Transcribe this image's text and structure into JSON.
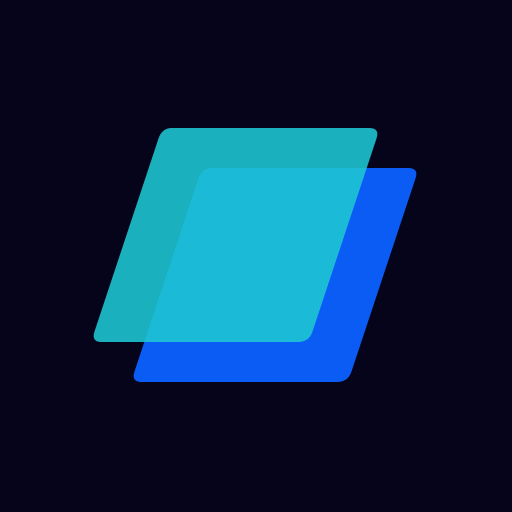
{
  "icon": {
    "name": "layered-parallelograms-logo",
    "colors": {
      "background": "#05041A",
      "back_layer": "#0A5CF5",
      "front_layer": "#1EC8D4",
      "front_layer_opacity": 0.88
    }
  }
}
